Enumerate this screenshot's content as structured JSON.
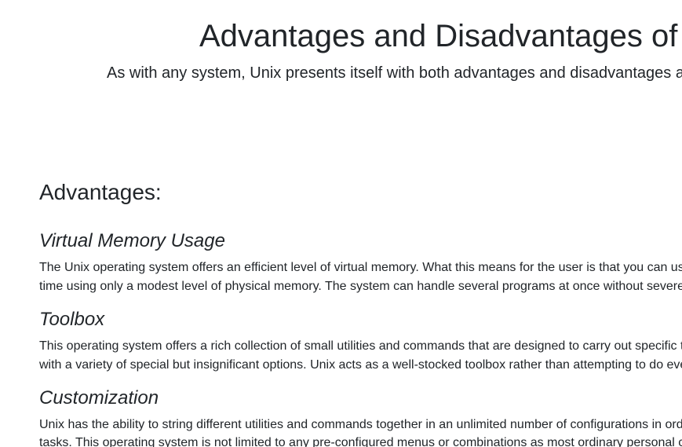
{
  "header": {
    "title": "Advantages and Disadvantages of",
    "subtitle": "As with any system, Unix presents itself with both advantages and disadvantages a"
  },
  "advantages": {
    "heading": "Advantages:",
    "items": [
      {
        "title": "Virtual Memory Usage",
        "lines": [
          "The Unix operating system offers an efficient level of virtual memory. What this means for the user is that you can us",
          "time using only a modest level of physical memory. The system can handle several programs at once without severe"
        ]
      },
      {
        "title": "Toolbox",
        "lines": [
          "This operating system offers a rich collection of small utilities and commands that are designed to carry out specific t",
          "with a variety of special but insignificant options. Unix acts as a well-stocked toolbox rather than attempting to do eve"
        ]
      },
      {
        "title": "Customization",
        "lines": [
          "Unix has the ability to string different utilities and commands together in an unlimited number of configurations in ord",
          "tasks. This operating system is not limited to any pre-configured menus or combinations as most ordinary personal c"
        ]
      }
    ]
  }
}
